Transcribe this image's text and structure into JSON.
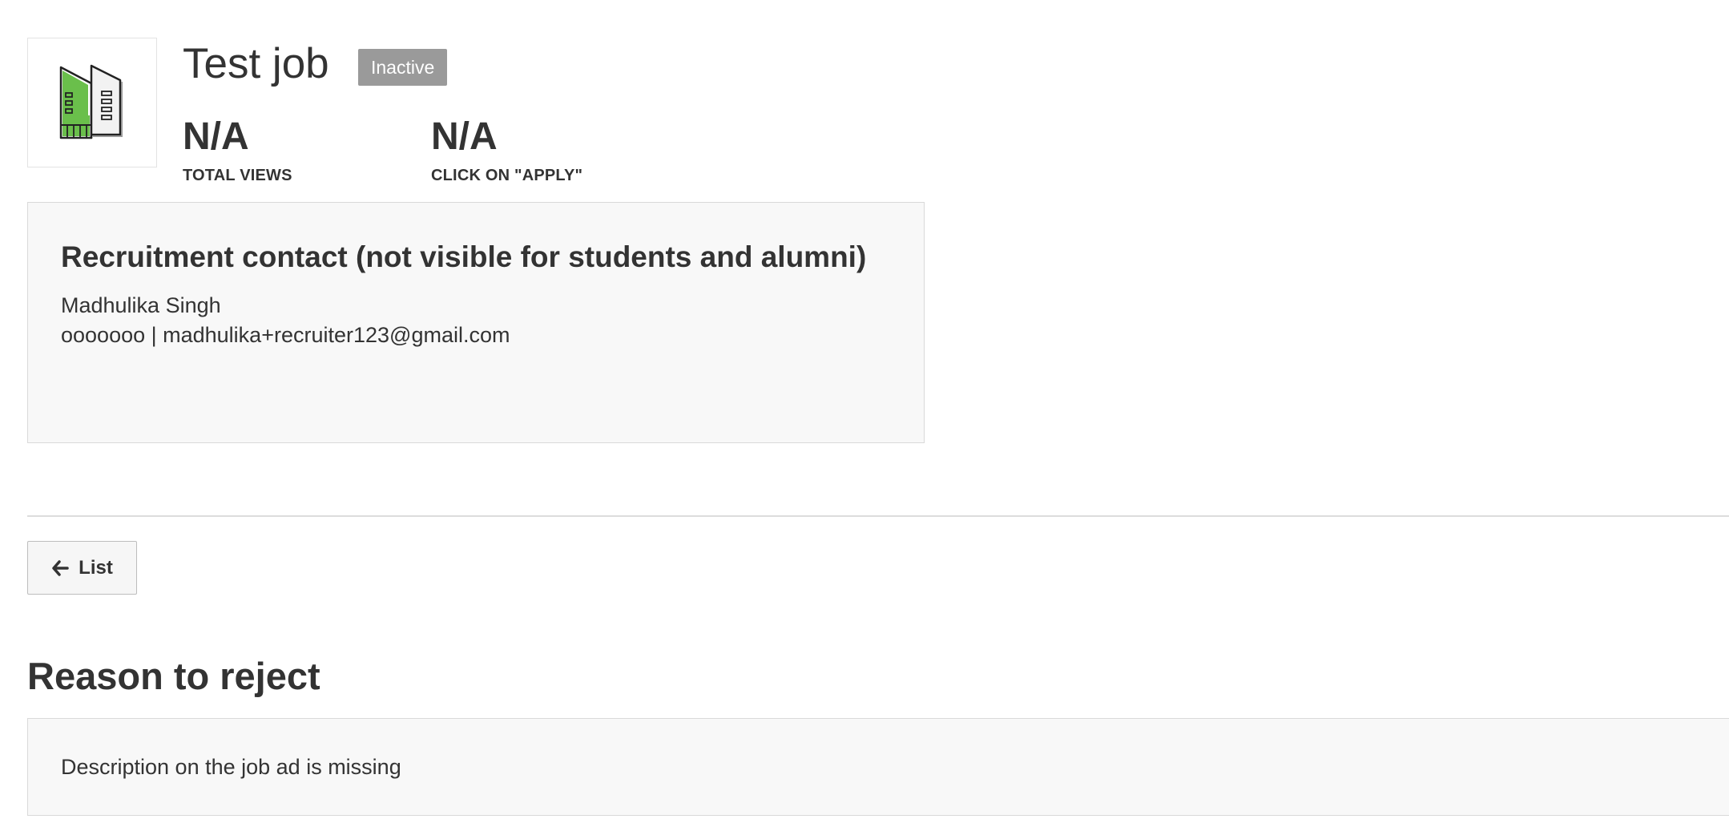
{
  "job": {
    "title": "Test job",
    "status": "Inactive",
    "logo_icon": "building-logo-icon",
    "accent_color": "#6abf4b"
  },
  "stats": [
    {
      "value": "N/A",
      "label": "TOTAL VIEWS"
    },
    {
      "value": "N/A",
      "label": "CLICK ON \"APPLY\""
    }
  ],
  "contact": {
    "heading": "Recruitment contact (not visible for students and alumni)",
    "name": "Madhulika Singh",
    "details": "ooooooo | madhulika+recruiter123@gmail.com"
  },
  "actions": {
    "back_icon": "arrow-left-icon",
    "back_label": "List"
  },
  "rejection": {
    "heading": "Reason to reject",
    "text": "Description on the job ad is missing"
  }
}
